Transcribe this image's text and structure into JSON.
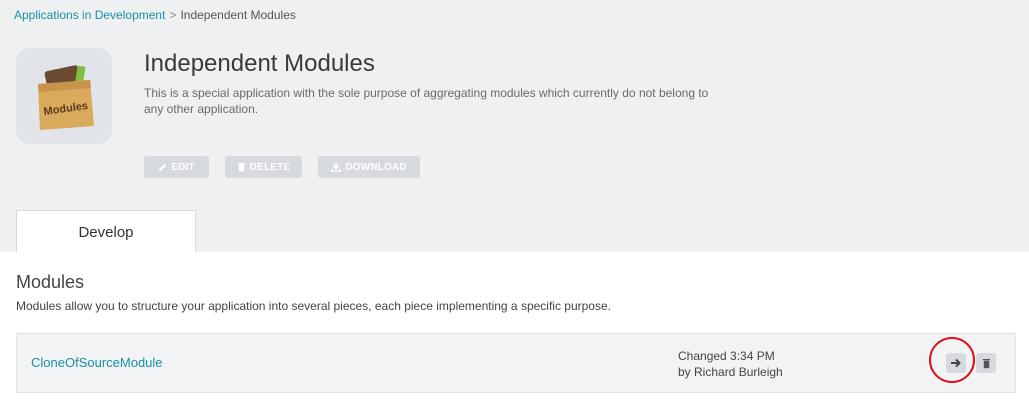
{
  "breadcrumb": {
    "parent": "Applications in Development",
    "separator": ">",
    "current": "Independent Modules"
  },
  "app": {
    "icon": "modules-box-icon",
    "icon_label": "Modules",
    "title": "Independent Modules",
    "description": "This is a special application with the sole purpose of aggregating modules which currently do not belong to any other application."
  },
  "actions": {
    "edit": "EDIT",
    "delete": "DELETE",
    "download": "DOWNLOAD"
  },
  "tabs": [
    {
      "label": "Develop",
      "selected": true
    }
  ],
  "modules_section": {
    "title": "Modules",
    "description": "Modules allow you to structure your application into several pieces, each piece implementing a specific purpose.",
    "items": [
      {
        "name": "CloneOfSourceModule",
        "changed": "Changed 3:34 PM",
        "by": "by Richard Burleigh"
      }
    ]
  },
  "colors": {
    "accent_link": "#1a8fa8",
    "highlight_ring": "#d9121b",
    "disabled_button": "#d6d9dd"
  }
}
